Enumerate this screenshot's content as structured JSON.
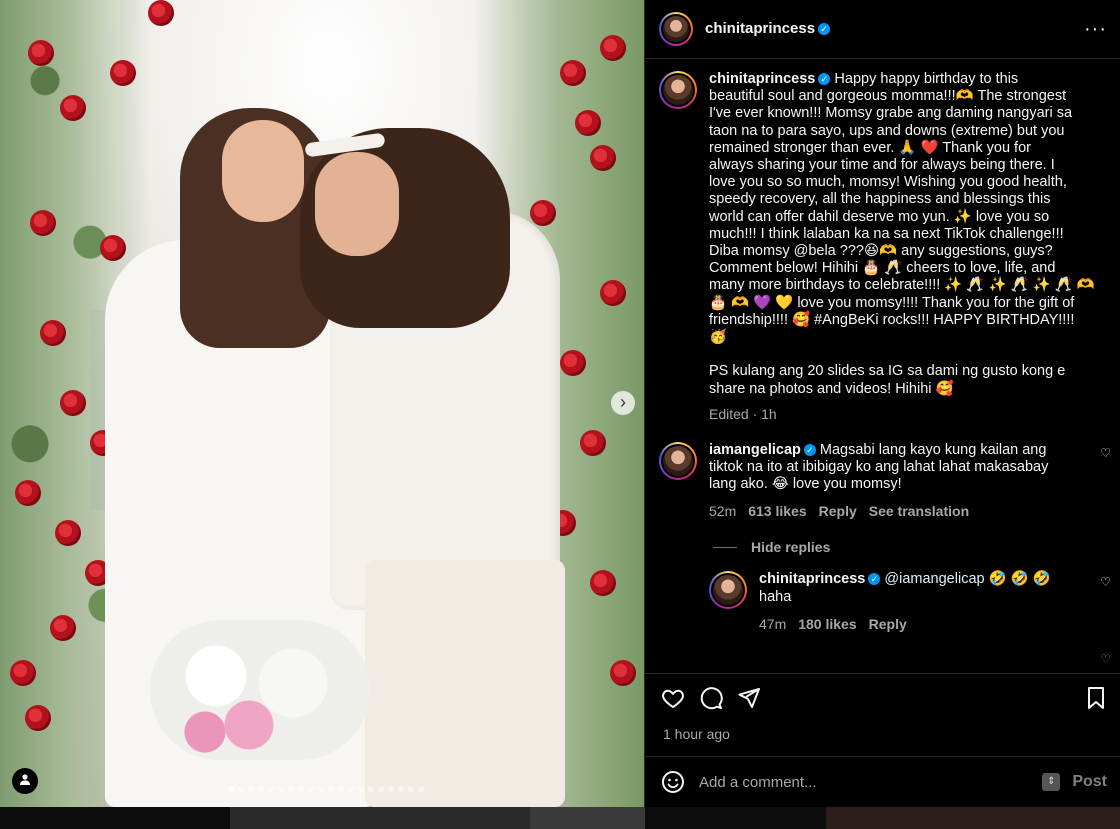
{
  "post": {
    "author": "chinitaprincess",
    "caption_lines": [
      "Happy happy birthday to this",
      "beautiful soul and gorgeous momma!!!🫶 The strongest",
      "I've ever known!!! Momsy grabe ang daming nangyari sa",
      "taon na to para sayo, ups and downs (extreme) but you",
      "remained stronger than ever. 🙏 ❤️ Thank you for",
      "always sharing your time and for always being there. I",
      "love you so so much, momsy! Wishing you good health,",
      "speedy recovery, all the happiness and blessings this",
      "world can offer dahil deserve mo yun. ✨ love you so",
      "much!!! I think lalaban ka na sa next TikTok challenge!!!",
      "Diba momsy @bela ???😆🫶 any suggestions, guys?",
      "Comment below! Hihihi 🎂 🥂 cheers to love, life, and",
      "many more birthdays to celebrate!!!! ✨ 🥂 ✨ 🥂 ✨ 🥂 🫶",
      "🎂 🫶 💜 💛 love you momsy!!!! Thank you for the gift of",
      "friendship!!!! 🥰 #AngBeKi rocks!!! HAPPY BIRTHDAY!!!!",
      "🥳"
    ],
    "ps_lines": [
      "PS kulang ang 20 slides sa IG sa dami ng gusto kong e",
      "share na photos and videos! Hihihi 🥰"
    ],
    "edited": "Edited · 1h",
    "time_ago": "1 hour ago"
  },
  "comments": [
    {
      "user": "iamangelicap",
      "lines": [
        "Magsabi lang kayo kung kailan ang",
        "tiktok na ito at ibibigay ko ang lahat lahat makasabay",
        "lang ako. 😂 love you momsy!"
      ],
      "time": "52m",
      "likes": "613 likes",
      "reply": "Reply",
      "translate": "See translation",
      "hide_replies": "Hide replies"
    }
  ],
  "reply": {
    "user": "chinitaprincess",
    "mention": "@iamangelicap",
    "emojis": "🤣 🤣 🤣",
    "text": "haha",
    "time": "47m",
    "likes": "180 likes",
    "reply": "Reply"
  },
  "comment_box": {
    "placeholder": "Add a comment...",
    "post": "Post"
  },
  "colors": {
    "verified": "#0095f6",
    "muted": "#a8a8a8"
  }
}
